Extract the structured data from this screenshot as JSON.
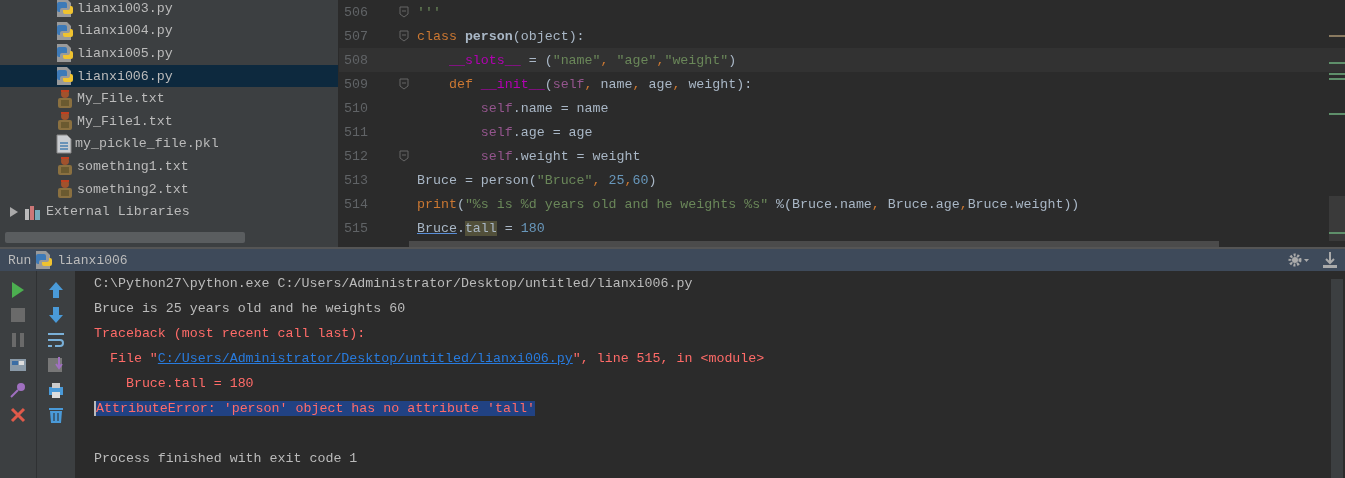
{
  "project_tree": {
    "files": [
      {
        "name": "lianxi003.py",
        "kind": "python",
        "selected": false
      },
      {
        "name": "lianxi004.py",
        "kind": "python",
        "selected": false
      },
      {
        "name": "lianxi005.py",
        "kind": "python",
        "selected": false
      },
      {
        "name": "lianxi006.py",
        "kind": "python",
        "selected": true
      },
      {
        "name": "My_File.txt",
        "kind": "figure",
        "selected": false
      },
      {
        "name": "My_File1.txt",
        "kind": "figure",
        "selected": false
      },
      {
        "name": "my_pickle_file.pkl",
        "kind": "document",
        "selected": false
      },
      {
        "name": "something1.txt",
        "kind": "figure",
        "selected": false
      },
      {
        "name": "something2.txt",
        "kind": "figure",
        "selected": false
      }
    ],
    "external_libraries": {
      "label": "External Libraries",
      "expanded": false
    }
  },
  "editor": {
    "lines": [
      {
        "number": "506",
        "fold": true,
        "current": false,
        "tokens": [
          {
            "text": "'''",
            "kind": "string"
          }
        ]
      },
      {
        "number": "507",
        "fold": true,
        "current": false,
        "tokens": [
          {
            "text": "class ",
            "kind": "keyword"
          },
          {
            "text": "person",
            "kind": "name"
          },
          {
            "text": "(object):",
            "kind": "plain"
          }
        ]
      },
      {
        "number": "508",
        "fold": false,
        "current": true,
        "tokens": [
          {
            "text": "    __slots__",
            "kind": "magic"
          },
          {
            "text": " = (",
            "kind": "plain"
          },
          {
            "text": "\"name\"",
            "kind": "string"
          },
          {
            "text": ", ",
            "kind": "keyword"
          },
          {
            "text": "\"age\"",
            "kind": "string"
          },
          {
            "text": ",",
            "kind": "keyword"
          },
          {
            "text": "\"weight\"",
            "kind": "string"
          },
          {
            "text": ")",
            "kind": "plain"
          }
        ]
      },
      {
        "number": "509",
        "fold": true,
        "current": false,
        "tokens": [
          {
            "text": "    def ",
            "kind": "keyword"
          },
          {
            "text": "__init__",
            "kind": "magic"
          },
          {
            "text": "(",
            "kind": "plain"
          },
          {
            "text": "self",
            "kind": "self"
          },
          {
            "text": ", ",
            "kind": "keyword"
          },
          {
            "text": "name",
            "kind": "plain"
          },
          {
            "text": ", ",
            "kind": "keyword"
          },
          {
            "text": "age",
            "kind": "plain"
          },
          {
            "text": ", ",
            "kind": "keyword"
          },
          {
            "text": "weight):",
            "kind": "plain"
          }
        ]
      },
      {
        "number": "510",
        "fold": false,
        "current": false,
        "tokens": [
          {
            "text": "        self",
            "kind": "self"
          },
          {
            "text": ".name = name",
            "kind": "plain"
          }
        ]
      },
      {
        "number": "511",
        "fold": false,
        "current": false,
        "tokens": [
          {
            "text": "        self",
            "kind": "self"
          },
          {
            "text": ".age = age",
            "kind": "plain"
          }
        ]
      },
      {
        "number": "512",
        "fold": true,
        "current": false,
        "tokens": [
          {
            "text": "        self",
            "kind": "self"
          },
          {
            "text": ".weight = weight",
            "kind": "plain"
          }
        ]
      },
      {
        "number": "513",
        "fold": false,
        "current": false,
        "tokens": [
          {
            "text": "Bruce = person(",
            "kind": "plain"
          },
          {
            "text": "\"Bruce\"",
            "kind": "string"
          },
          {
            "text": ", ",
            "kind": "keyword"
          },
          {
            "text": "25",
            "kind": "number"
          },
          {
            "text": ",",
            "kind": "keyword"
          },
          {
            "text": "60",
            "kind": "number"
          },
          {
            "text": ")",
            "kind": "plain"
          }
        ]
      },
      {
        "number": "514",
        "fold": false,
        "current": false,
        "tokens": [
          {
            "text": "print",
            "kind": "keyword"
          },
          {
            "text": "(",
            "kind": "plain"
          },
          {
            "text": "\"%s is %d years old and he weights %s\"",
            "kind": "string"
          },
          {
            "text": " %(Bruce.name",
            "kind": "plain"
          },
          {
            "text": ", ",
            "kind": "keyword"
          },
          {
            "text": "Bruce.age",
            "kind": "plain"
          },
          {
            "text": ",",
            "kind": "keyword"
          },
          {
            "text": "Bruce.weight))",
            "kind": "plain"
          }
        ]
      },
      {
        "number": "515",
        "fold": false,
        "current": false,
        "tokens": [
          {
            "text": "Bruce",
            "kind": "reference"
          },
          {
            "text": ".",
            "kind": "plain"
          },
          {
            "text": "tall",
            "kind": "highlight"
          },
          {
            "text": " = ",
            "kind": "plain"
          },
          {
            "text": "180",
            "kind": "number"
          }
        ]
      }
    ]
  },
  "run_panel": {
    "label": "Run",
    "config": "lianxi006",
    "output": [
      {
        "kind": "plain",
        "parts": [
          {
            "text": "C:\\Python27\\python.exe C:/Users/Administrator/Desktop/untitled/lianxi006.py",
            "kind": "text"
          }
        ]
      },
      {
        "kind": "plain",
        "parts": [
          {
            "text": "Bruce is 25 years old and he weights 60",
            "kind": "text"
          }
        ]
      },
      {
        "kind": "error",
        "parts": [
          {
            "text": "Traceback (most recent call last):",
            "kind": "text"
          }
        ]
      },
      {
        "kind": "error",
        "parts": [
          {
            "text": "  File \"",
            "kind": "text"
          },
          {
            "text": "C:/Users/Administrator/Desktop/untitled/lianxi006.py",
            "kind": "link"
          },
          {
            "text": "\", line 515, in <module>",
            "kind": "text"
          }
        ]
      },
      {
        "kind": "error",
        "parts": [
          {
            "text": "    Bruce.tall = 180",
            "kind": "text"
          }
        ]
      },
      {
        "kind": "highlighted",
        "parts": [
          {
            "text": "AttributeError: 'person' object has no attribute 'tall'",
            "kind": "text"
          }
        ]
      },
      {
        "kind": "blank"
      },
      {
        "kind": "plain",
        "parts": [
          {
            "text": "Process finished with exit code 1",
            "kind": "text"
          }
        ]
      }
    ]
  }
}
